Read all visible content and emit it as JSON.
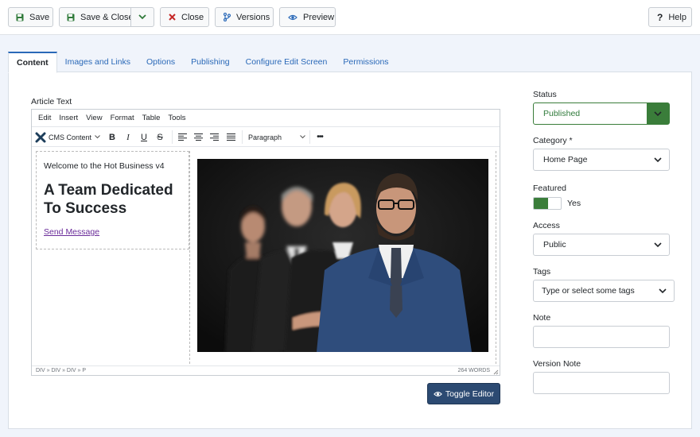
{
  "toolbar": {
    "save": "Save",
    "save_close": "Save & Close",
    "close": "Close",
    "versions": "Versions",
    "preview": "Preview",
    "help": "Help"
  },
  "tabs": [
    "Content",
    "Images and Links",
    "Options",
    "Publishing",
    "Configure Edit Screen",
    "Permissions"
  ],
  "editor": {
    "label": "Article Text",
    "menu": [
      "Edit",
      "Insert",
      "View",
      "Format",
      "Table",
      "Tools"
    ],
    "cms_content": "CMS Content",
    "format_select": "Paragraph",
    "more": "•••",
    "welcome": "Welcome to the Hot Business v4",
    "heading": "A Team Dedicated To Success",
    "link": "Send Message",
    "path": "DIV » DIV » DIV » P",
    "word_count": "264 WORDS",
    "toggle": "Toggle Editor"
  },
  "sidebar": {
    "status_label": "Status",
    "status_value": "Published",
    "category_label": "Category *",
    "category_value": "Home Page",
    "featured_label": "Featured",
    "featured_value": "Yes",
    "featured_on": true,
    "access_label": "Access",
    "access_value": "Public",
    "tags_label": "Tags",
    "tags_placeholder": "Type or select some tags",
    "note_label": "Note",
    "note_value": "",
    "version_note_label": "Version Note",
    "version_note_value": ""
  },
  "colors": {
    "published_green": "#3a7d3a",
    "link_blue": "#2a69b8",
    "toggle_btn": "#2c4a72"
  },
  "icons": [
    "save-icon",
    "check-icon",
    "chevron-down-icon",
    "close-icon",
    "versions-icon",
    "eye-icon",
    "question-icon",
    "joomla-icon",
    "bold-icon",
    "italic-icon",
    "underline-icon",
    "strikethrough-icon",
    "align-left-icon",
    "align-center-icon",
    "align-right-icon",
    "align-justify-icon"
  ]
}
